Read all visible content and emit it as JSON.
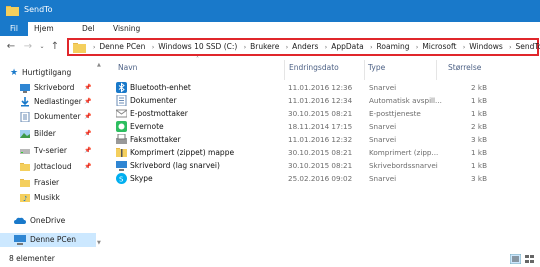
{
  "window": {
    "title": "SendTo"
  },
  "ribbon": {
    "tabs": [
      "Fil",
      "Hjem",
      "Del",
      "Visning"
    ]
  },
  "address": {
    "crumbs": [
      "Denne PCen",
      "Windows 10 SSD (C:)",
      "Brukere",
      "Anders",
      "AppData",
      "Roaming",
      "Microsoft",
      "Windows",
      "SendTo"
    ]
  },
  "sidebar": {
    "items": [
      {
        "label": "Hurtigtilgang",
        "icon": "star-icon"
      },
      {
        "label": "Skrivebord",
        "icon": "desktop-icon"
      },
      {
        "label": "Nedlastinger",
        "icon": "download-icon"
      },
      {
        "label": "Dokumenter",
        "icon": "documents-icon"
      },
      {
        "label": "Bilder",
        "icon": "pictures-icon"
      },
      {
        "label": "Tv-serier",
        "icon": "drive-icon"
      },
      {
        "label": "Jottacloud",
        "icon": "folder-icon"
      },
      {
        "label": "Frasier",
        "icon": "folder-icon"
      },
      {
        "label": "Musikk",
        "icon": "music-icon"
      },
      {
        "label": "OneDrive",
        "icon": "cloud-icon"
      },
      {
        "label": "Denne PCen",
        "icon": "computer-icon"
      }
    ]
  },
  "columns": {
    "name": "Navn",
    "date": "Endringsdato",
    "type": "Type",
    "size": "Størrelse"
  },
  "files": [
    {
      "name": "Bluetooth-enhet",
      "date": "11.01.2016 12:36",
      "type": "Snarvei",
      "size": "2 kB",
      "icon": "bluetooth-icon"
    },
    {
      "name": "Dokumenter",
      "date": "11.01.2016 12:34",
      "type": "Automatisk avspill...",
      "size": "1 kB",
      "icon": "documents-icon"
    },
    {
      "name": "E-postmottaker",
      "date": "30.10.2015 08:21",
      "type": "E-posttjeneste",
      "size": "1 kB",
      "icon": "mail-icon"
    },
    {
      "name": "Evernote",
      "date": "18.11.2014 17:15",
      "type": "Snarvei",
      "size": "2 kB",
      "icon": "evernote-icon"
    },
    {
      "name": "Faksmottaker",
      "date": "11.01.2016 12:32",
      "type": "Snarvei",
      "size": "3 kB",
      "icon": "fax-icon"
    },
    {
      "name": "Komprimert (zippet) mappe",
      "date": "30.10.2015 08:21",
      "type": "Komprimert (zipp...",
      "size": "1 kB",
      "icon": "zip-folder-icon"
    },
    {
      "name": "Skrivebord (lag snarvei)",
      "date": "30.10.2015 08:21",
      "type": "Skrivebordssnarvei",
      "size": "1 kB",
      "icon": "desktop-icon"
    },
    {
      "name": "Skype",
      "date": "25.02.2016 09:02",
      "type": "Snarvei",
      "size": "3 kB",
      "icon": "skype-icon"
    }
  ],
  "status": {
    "count": "8 elementer"
  }
}
